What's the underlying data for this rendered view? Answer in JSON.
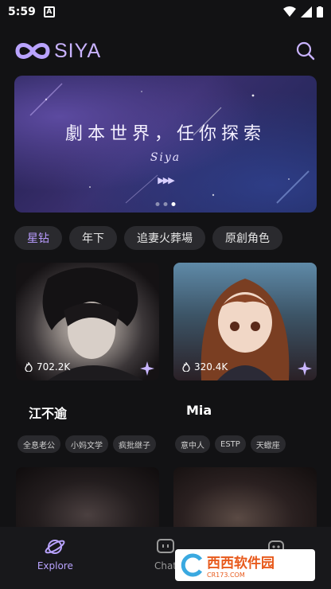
{
  "status": {
    "time": "5:59",
    "notif": "A"
  },
  "app": {
    "name": "SIYA"
  },
  "banner": {
    "title": "劇本世界，任你探索",
    "subtitle": "Siya",
    "arrows": "▶▶▶"
  },
  "tags": [
    "星钻",
    "年下",
    "追妻火葬場",
    "原創角色"
  ],
  "cards": [
    {
      "name": "江不逾",
      "count": "702.2K",
      "tags": [
        "全息老公",
        "小妈文学",
        "疯批继子"
      ]
    },
    {
      "name": "Mia",
      "count": "320.4K",
      "tags": [
        "意中人",
        "ESTP",
        "天蠍座"
      ]
    }
  ],
  "nav": [
    {
      "label": "Explore"
    },
    {
      "label": "Chat"
    },
    {
      "label": ""
    }
  ],
  "watermark": {
    "text": "西西软件园",
    "url": "CR173.COM"
  },
  "colors": {
    "accent": "#b9a3ff",
    "background": "#121214"
  }
}
